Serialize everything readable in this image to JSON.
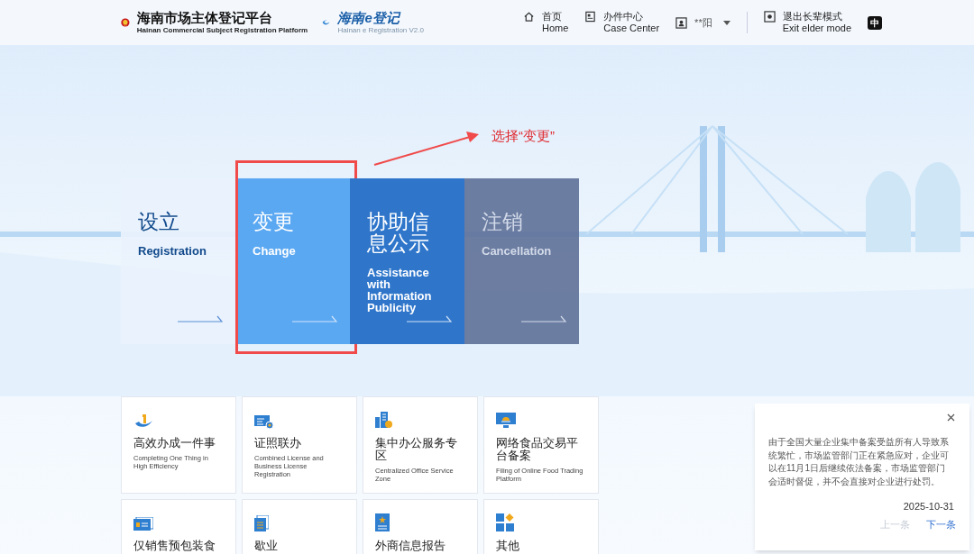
{
  "header": {
    "title": "海南市场主体登记平台",
    "subtitle": "Hainan Commercial Subject Registration Platform",
    "brand": "海南e登记",
    "brand_sub": "Hainan e Registration V2.0",
    "nav": [
      {
        "kind": "home",
        "zh": "首页",
        "en": "Home"
      },
      {
        "kind": "case",
        "zh": "办件中心",
        "en": "Case Center"
      }
    ],
    "user": "**阳",
    "elder": {
      "zh": "退出长辈模式",
      "en": "Exit elder mode"
    },
    "language": "中"
  },
  "annotation": {
    "label": "选择“变更”"
  },
  "features": [
    {
      "kind": "light",
      "zh": "设立",
      "en": "Registration",
      "highlighted": false
    },
    {
      "kind": "blue",
      "zh": "变更",
      "en": "Change",
      "highlighted": true
    },
    {
      "kind": "dark",
      "zh": "协助信息公示",
      "en": "Assistance with Information Publicity",
      "highlighted": false
    },
    {
      "kind": "slate",
      "zh": "注销",
      "en": "Cancellation",
      "highlighted": false
    }
  ],
  "services": [
    {
      "kind": "one",
      "zh": "高效办成一件事",
      "en": "Completing One Thing in High Efficiency"
    },
    {
      "kind": "license",
      "zh": "证照联办",
      "en": "Combined License and Business License Registration"
    },
    {
      "kind": "building",
      "zh": "集中办公服务专区",
      "en": "Centralized Office Service Zone"
    },
    {
      "kind": "monitor",
      "zh": "网络食品交易平台备案",
      "en": "Filing of Online Food Trading Platform"
    },
    {
      "kind": "card",
      "zh": "仅销售预包装食"
    },
    {
      "kind": "docs",
      "zh": "歇业"
    },
    {
      "kind": "report",
      "zh": "外商信息报告"
    },
    {
      "kind": "grid",
      "zh": "其他"
    }
  ],
  "notice": {
    "text": "由于全国大量企业集中备案受益所有人导致系统繁忙，市场监管部门正在紧急应对，企业可以在11月1日后继续依法备案，市场监管部门会适时督促，并不会直接对企业进行处罚。",
    "date": "2025-10-31",
    "prev": {
      "label": "上一条",
      "disabled": true
    },
    "next": {
      "label": "下一条",
      "disabled": false
    }
  }
}
